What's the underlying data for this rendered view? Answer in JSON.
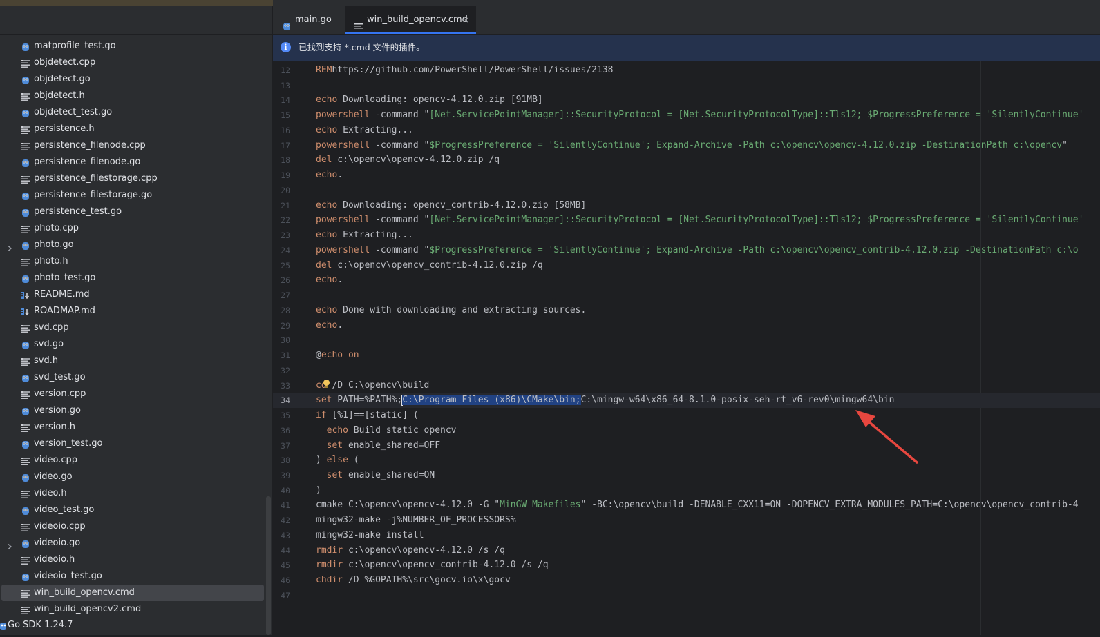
{
  "sidebar": {
    "items": [
      {
        "name": "matprofile_test.go",
        "type": "go"
      },
      {
        "name": "objdetect.cpp",
        "type": "text"
      },
      {
        "name": "objdetect.go",
        "type": "go"
      },
      {
        "name": "objdetect.h",
        "type": "text"
      },
      {
        "name": "objdetect_test.go",
        "type": "go"
      },
      {
        "name": "persistence.h",
        "type": "text"
      },
      {
        "name": "persistence_filenode.cpp",
        "type": "text"
      },
      {
        "name": "persistence_filenode.go",
        "type": "go"
      },
      {
        "name": "persistence_filestorage.cpp",
        "type": "text"
      },
      {
        "name": "persistence_filestorage.go",
        "type": "go"
      },
      {
        "name": "persistence_test.go",
        "type": "go"
      },
      {
        "name": "photo.cpp",
        "type": "text"
      },
      {
        "name": "photo.go",
        "type": "go",
        "expandable": true
      },
      {
        "name": "photo.h",
        "type": "text"
      },
      {
        "name": "photo_test.go",
        "type": "go"
      },
      {
        "name": "README.md",
        "type": "md"
      },
      {
        "name": "ROADMAP.md",
        "type": "md"
      },
      {
        "name": "svd.cpp",
        "type": "text"
      },
      {
        "name": "svd.go",
        "type": "go"
      },
      {
        "name": "svd.h",
        "type": "text"
      },
      {
        "name": "svd_test.go",
        "type": "go"
      },
      {
        "name": "version.cpp",
        "type": "text"
      },
      {
        "name": "version.go",
        "type": "go"
      },
      {
        "name": "version.h",
        "type": "text"
      },
      {
        "name": "version_test.go",
        "type": "go"
      },
      {
        "name": "video.cpp",
        "type": "text"
      },
      {
        "name": "video.go",
        "type": "go"
      },
      {
        "name": "video.h",
        "type": "text"
      },
      {
        "name": "video_test.go",
        "type": "go"
      },
      {
        "name": "videoio.cpp",
        "type": "text"
      },
      {
        "name": "videoio.go",
        "type": "go",
        "expandable": true
      },
      {
        "name": "videoio.h",
        "type": "text"
      },
      {
        "name": "videoio_test.go",
        "type": "go"
      },
      {
        "name": "win_build_opencv.cmd",
        "type": "text",
        "selected": true
      },
      {
        "name": "win_build_opencv2.cmd",
        "type": "text"
      }
    ],
    "sdk_label": "Go SDK 1.24.7"
  },
  "tabs": [
    {
      "label": "main.go",
      "icon": "go-gopher-icon",
      "active": false
    },
    {
      "label": "win_build_opencv.cmd",
      "icon": "text-file-icon",
      "active": true,
      "close": "×"
    }
  ],
  "banner": {
    "icon": "info-icon",
    "text": "已找到支持 *.cmd 文件的插件。"
  },
  "editor": {
    "current_line": 34,
    "lines": [
      {
        "n": "12",
        "segs": [
          [
            "kw",
            "REM"
          ],
          [
            "",
            "https://github.com/PowerShell/PowerShell/issues/2138"
          ]
        ]
      },
      {
        "n": "13",
        "segs": []
      },
      {
        "n": "14",
        "segs": [
          [
            "kw",
            "echo"
          ],
          [
            "",
            " Downloading: opencv-4.12.0.zip [91MB]"
          ]
        ]
      },
      {
        "n": "15",
        "segs": [
          [
            "kw",
            "powershell"
          ],
          [
            "",
            " -command \""
          ],
          [
            "str",
            "[Net.ServicePointManager]::SecurityProtocol = [Net.SecurityProtocolType]::Tls12; $ProgressPreference = 'SilentlyContinue'"
          ]
        ]
      },
      {
        "n": "16",
        "segs": [
          [
            "kw",
            "echo"
          ],
          [
            "",
            " Extracting..."
          ]
        ]
      },
      {
        "n": "17",
        "segs": [
          [
            "kw",
            "powershell"
          ],
          [
            "",
            " -command \""
          ],
          [
            "str",
            "$ProgressPreference = 'SilentlyContinue'; Expand-Archive -Path c:\\opencv\\opencv-4.12.0.zip -DestinationPath c:\\opencv"
          ],
          [
            "",
            "\""
          ]
        ]
      },
      {
        "n": "18",
        "segs": [
          [
            "kw",
            "del"
          ],
          [
            "",
            " c:\\opencv\\opencv-4.12.0.zip /q"
          ]
        ]
      },
      {
        "n": "19",
        "segs": [
          [
            "kw",
            "echo"
          ],
          [
            "",
            "."
          ]
        ]
      },
      {
        "n": "20",
        "segs": []
      },
      {
        "n": "21",
        "segs": [
          [
            "kw",
            "echo"
          ],
          [
            "",
            " Downloading: opencv_contrib-4.12.0.zip [58MB]"
          ]
        ]
      },
      {
        "n": "22",
        "segs": [
          [
            "kw",
            "powershell"
          ],
          [
            "",
            " -command \""
          ],
          [
            "str",
            "[Net.ServicePointManager]::SecurityProtocol = [Net.SecurityProtocolType]::Tls12; $ProgressPreference = 'SilentlyContinue'"
          ]
        ]
      },
      {
        "n": "23",
        "segs": [
          [
            "kw",
            "echo"
          ],
          [
            "",
            " Extracting..."
          ]
        ]
      },
      {
        "n": "24",
        "segs": [
          [
            "kw",
            "powershell"
          ],
          [
            "",
            " -command \""
          ],
          [
            "str",
            "$ProgressPreference = 'SilentlyContinue'; Expand-Archive -Path c:\\opencv\\opencv_contrib-4.12.0.zip -DestinationPath c:\\o"
          ]
        ]
      },
      {
        "n": "25",
        "segs": [
          [
            "kw",
            "del"
          ],
          [
            "",
            " c:\\opencv\\opencv_contrib-4.12.0.zip /q"
          ]
        ]
      },
      {
        "n": "26",
        "segs": [
          [
            "kw",
            "echo"
          ],
          [
            "",
            "."
          ]
        ]
      },
      {
        "n": "27",
        "segs": []
      },
      {
        "n": "28",
        "segs": [
          [
            "kw",
            "echo"
          ],
          [
            "",
            " Done with downloading and extracting sources."
          ]
        ]
      },
      {
        "n": "29",
        "segs": [
          [
            "kw",
            "echo"
          ],
          [
            "",
            "."
          ]
        ]
      },
      {
        "n": "30",
        "segs": []
      },
      {
        "n": "31",
        "segs": [
          [
            "",
            "@"
          ],
          [
            "kw",
            "echo on"
          ]
        ]
      },
      {
        "n": "32",
        "segs": []
      },
      {
        "n": "33",
        "segs": [
          [
            "kw",
            "cd"
          ],
          [
            "",
            " /D C:\\opencv\\build"
          ]
        ],
        "bulb": true
      },
      {
        "n": "34",
        "segs": [
          [
            "kw",
            "set"
          ],
          [
            "",
            " PATH=%PATH%;"
          ],
          [
            "caret",
            ""
          ],
          [
            "sel",
            "C:\\Program Files (x86)\\CMake\\bin;"
          ],
          [
            "",
            "C:\\mingw-w64\\x86_64-8.1.0-posix-seh-rt_v6-rev0\\mingw64\\bin"
          ]
        ]
      },
      {
        "n": "35",
        "segs": [
          [
            "kw",
            "if"
          ],
          [
            "",
            " [%1]==[static] ("
          ]
        ]
      },
      {
        "n": "36",
        "segs": [
          [
            "",
            "  "
          ],
          [
            "kw",
            "echo"
          ],
          [
            "",
            " Build static opencv"
          ]
        ]
      },
      {
        "n": "37",
        "segs": [
          [
            "",
            "  "
          ],
          [
            "kw",
            "set"
          ],
          [
            "",
            " enable_shared=OFF"
          ]
        ]
      },
      {
        "n": "38",
        "segs": [
          [
            "",
            ") "
          ],
          [
            "kw",
            "else"
          ],
          [
            "",
            " ("
          ]
        ]
      },
      {
        "n": "39",
        "segs": [
          [
            "",
            "  "
          ],
          [
            "kw",
            "set"
          ],
          [
            "",
            " enable_shared=ON"
          ]
        ]
      },
      {
        "n": "40",
        "segs": [
          [
            "",
            ")"
          ]
        ]
      },
      {
        "n": "41",
        "segs": [
          [
            "",
            "cmake C:\\opencv\\opencv-4.12.0 -G \""
          ],
          [
            "str",
            "MinGW Makefiles"
          ],
          [
            "",
            "\" -BC:\\opencv\\build -DENABLE_CXX11=ON -DOPENCV_EXTRA_MODULES_PATH=C:\\opencv\\opencv_contrib-4"
          ]
        ]
      },
      {
        "n": "42",
        "segs": [
          [
            "",
            "mingw32-make -j%NUMBER_OF_PROCESSORS%"
          ]
        ]
      },
      {
        "n": "43",
        "segs": [
          [
            "",
            "mingw32-make install"
          ]
        ]
      },
      {
        "n": "44",
        "segs": [
          [
            "kw",
            "rmdir"
          ],
          [
            "",
            " c:\\opencv\\opencv-4.12.0 /s /q"
          ]
        ]
      },
      {
        "n": "45",
        "segs": [
          [
            "kw",
            "rmdir"
          ],
          [
            "",
            " c:\\opencv\\opencv_contrib-4.12.0 /s /q"
          ]
        ]
      },
      {
        "n": "46",
        "segs": [
          [
            "kw",
            "chdir"
          ],
          [
            "",
            " /D %GOPATH%\\src\\gocv.io\\x\\gocv"
          ]
        ]
      },
      {
        "n": "47",
        "segs": []
      }
    ]
  },
  "colors": {
    "keyword": "#cf8e6d",
    "string": "#6aab73",
    "selection": "#214283",
    "accent": "#3574f0",
    "arrow": "#e8473f"
  }
}
